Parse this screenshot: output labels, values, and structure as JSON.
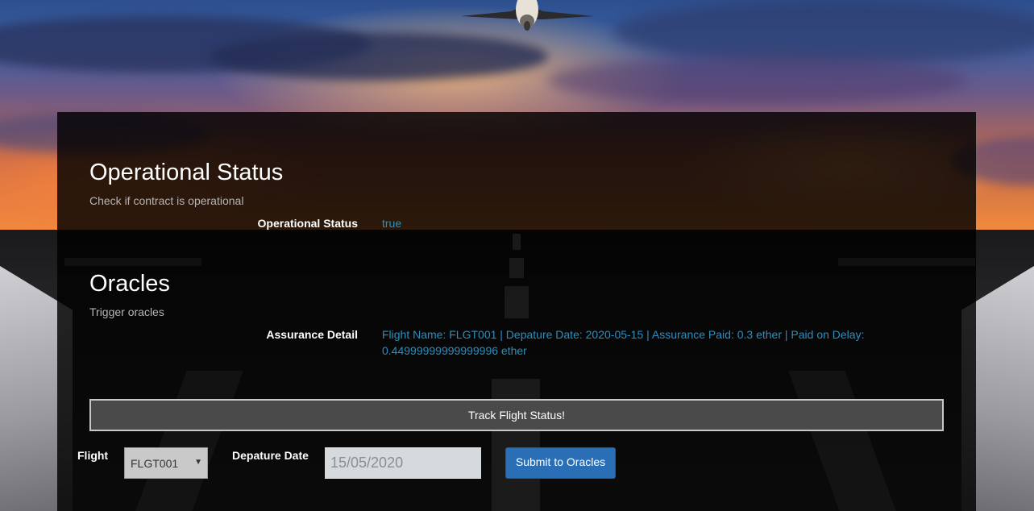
{
  "operational": {
    "title": "Operational Status",
    "subtitle": "Check if contract is operational",
    "label": "Operational Status",
    "value": "true"
  },
  "oracles": {
    "title": "Oracles",
    "subtitle": "Trigger oracles",
    "label": "Assurance Detail",
    "value_line1": "Flight Name: FLGT001 | Depature Date: 2020-05-15 | Assurance Paid: 0.3 ether | Paid on Delay:",
    "value_line2": "0.44999999999999996 ether"
  },
  "track_button": "Track Flight Status!",
  "form": {
    "flight_label": "Flight",
    "flight_selected": "FLGT001",
    "date_label": "Depature Date",
    "date_value": "15/05/2020",
    "submit_label": "Submit to Oracles"
  },
  "colors": {
    "value_text": "#2a8fc0",
    "submit_button": "#2a6fb6"
  }
}
